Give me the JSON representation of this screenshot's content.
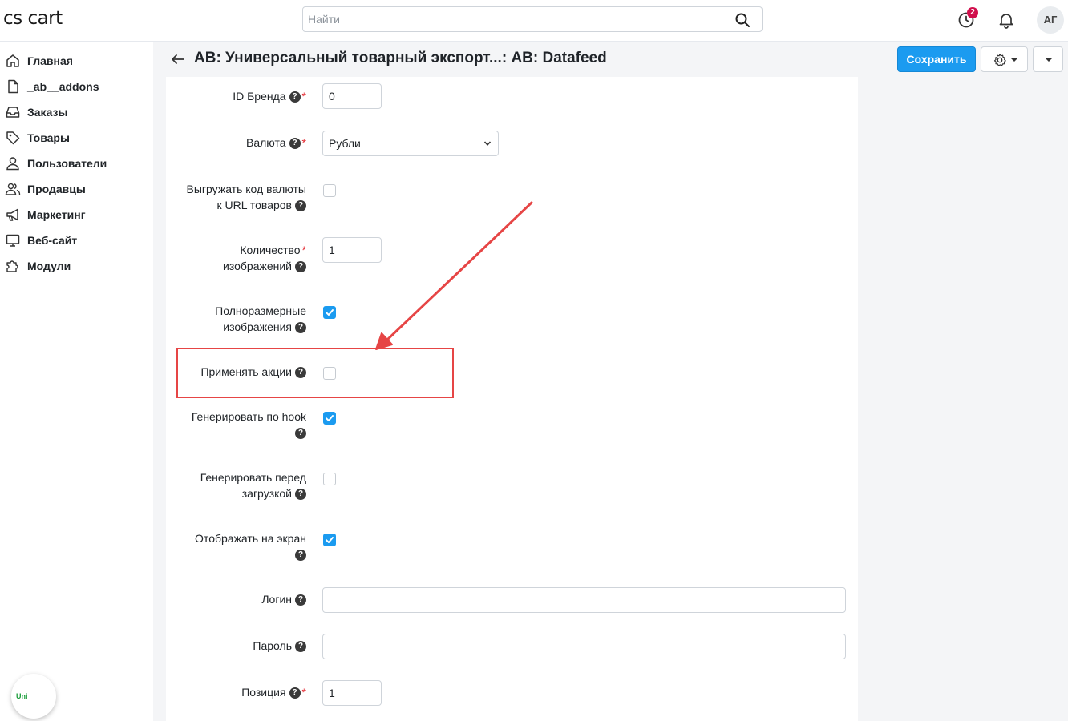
{
  "header": {
    "logo": "cs cart",
    "search_placeholder": "Найти",
    "notification_count": "2",
    "avatar_initials": "АГ"
  },
  "sidebar": {
    "items": [
      {
        "label": "Главная",
        "icon": "home-icon"
      },
      {
        "label": "_ab__addons",
        "icon": "file-icon"
      },
      {
        "label": "Заказы",
        "icon": "inbox-icon"
      },
      {
        "label": "Товары",
        "icon": "tag-icon"
      },
      {
        "label": "Пользователи",
        "icon": "user-icon"
      },
      {
        "label": "Продавцы",
        "icon": "users-icon"
      },
      {
        "label": "Маркетинг",
        "icon": "megaphone-icon"
      },
      {
        "label": "Веб-сайт",
        "icon": "monitor-icon"
      },
      {
        "label": "Модули",
        "icon": "puzzle-icon"
      }
    ],
    "widget_label": "Uni"
  },
  "page": {
    "title": "AB: Универсальный товарный экспорт...: AB: Datafeed",
    "save_label": "Сохранить"
  },
  "form": {
    "help_glyph": "?",
    "required_mark": "*",
    "brand_id": {
      "label": "ID Бренда",
      "value": "0"
    },
    "currency": {
      "label": "Валюта",
      "value": "Рубли"
    },
    "export_currency_code": {
      "label_line1": "Выгружать код валюты",
      "label_line2": "к URL товаров",
      "checked": false
    },
    "images_count": {
      "label_line1": "Количество",
      "label_line2": "изображений",
      "value": "1"
    },
    "full_size_images": {
      "label_line1": "Полноразмерные",
      "label_line2": "изображения",
      "checked": true
    },
    "apply_promotions": {
      "label": "Применять акции",
      "checked": false
    },
    "generate_by_hook": {
      "label_line1": "Генерировать по hook",
      "checked": true
    },
    "generate_before_download": {
      "label_line1": "Генерировать перед",
      "label_line2": "загрузкой",
      "checked": false
    },
    "display_on_screen": {
      "label_line1": "Отображать на экран",
      "checked": true
    },
    "login": {
      "label": "Логин",
      "value": ""
    },
    "password": {
      "label": "Пароль",
      "value": ""
    },
    "position": {
      "label": "Позиция",
      "value": "1"
    }
  },
  "colors": {
    "accent": "#1b9bf0",
    "annotation": "#e64545",
    "badge": "#d10f4c"
  }
}
